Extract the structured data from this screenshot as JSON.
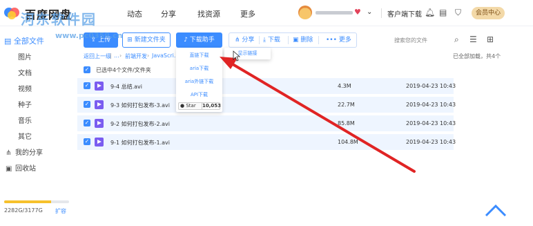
{
  "app": {
    "title": "百度网盘"
  },
  "nav": {
    "items": [
      "动态",
      "分享",
      "找资源",
      "更多"
    ]
  },
  "header": {
    "client_download": "客户端下载",
    "vip_center": "会员中心"
  },
  "sidebar": {
    "all_files": "全部文件",
    "categories": [
      "图片",
      "文档",
      "视频",
      "种子",
      "音乐",
      "其它"
    ],
    "my_share": "我的分享",
    "recycle": "回收站",
    "quota_text": "2282G/3177G",
    "quota_fraction": 0.72,
    "expand": "扩容"
  },
  "toolbar": {
    "upload": "上传",
    "new_folder": "新建文件夹",
    "download_helper": "下载助手",
    "share": "分享",
    "download": "下载",
    "delete": "删除",
    "more": "更多",
    "search_placeholder": "搜索您的文件"
  },
  "breadcrumb": {
    "back": "返回上一级",
    "dots": "...",
    "folder": "前端开发",
    "current": "JavaScri..."
  },
  "list": {
    "selected_text": "已选中4个文件/文件夹",
    "loaded_text": "已全部加载，共4个",
    "files": [
      {
        "name": "9-4 总结.avi",
        "size": "4.3M",
        "date": "2019-04-23 10:43"
      },
      {
        "name": "9-3 如何打包发布-3.avi",
        "size": "22.7M",
        "date": "2019-04-23 10:43"
      },
      {
        "name": "9-2 如何打包发布-2.avi",
        "size": "85.8M",
        "date": "2019-04-23 10:43"
      },
      {
        "name": "9-1 如何打包发布-1.avi",
        "size": "104.8M",
        "date": "2019-04-23 10:43"
      }
    ]
  },
  "download_menu": {
    "items": [
      "直链下载",
      "aria下载",
      "aria外链下载",
      "API下载"
    ],
    "star_label": "Star",
    "star_count": "10,053"
  },
  "link_menu": {
    "item": "显示链接"
  },
  "watermark": {
    "line1": "河东软件园",
    "line2": "www.pc0359.cn"
  },
  "colors": {
    "accent": "#3b8cff",
    "row_bg": "#eef5ff",
    "arrow": "#e02424",
    "vip_bg": "#f3d9a8"
  }
}
